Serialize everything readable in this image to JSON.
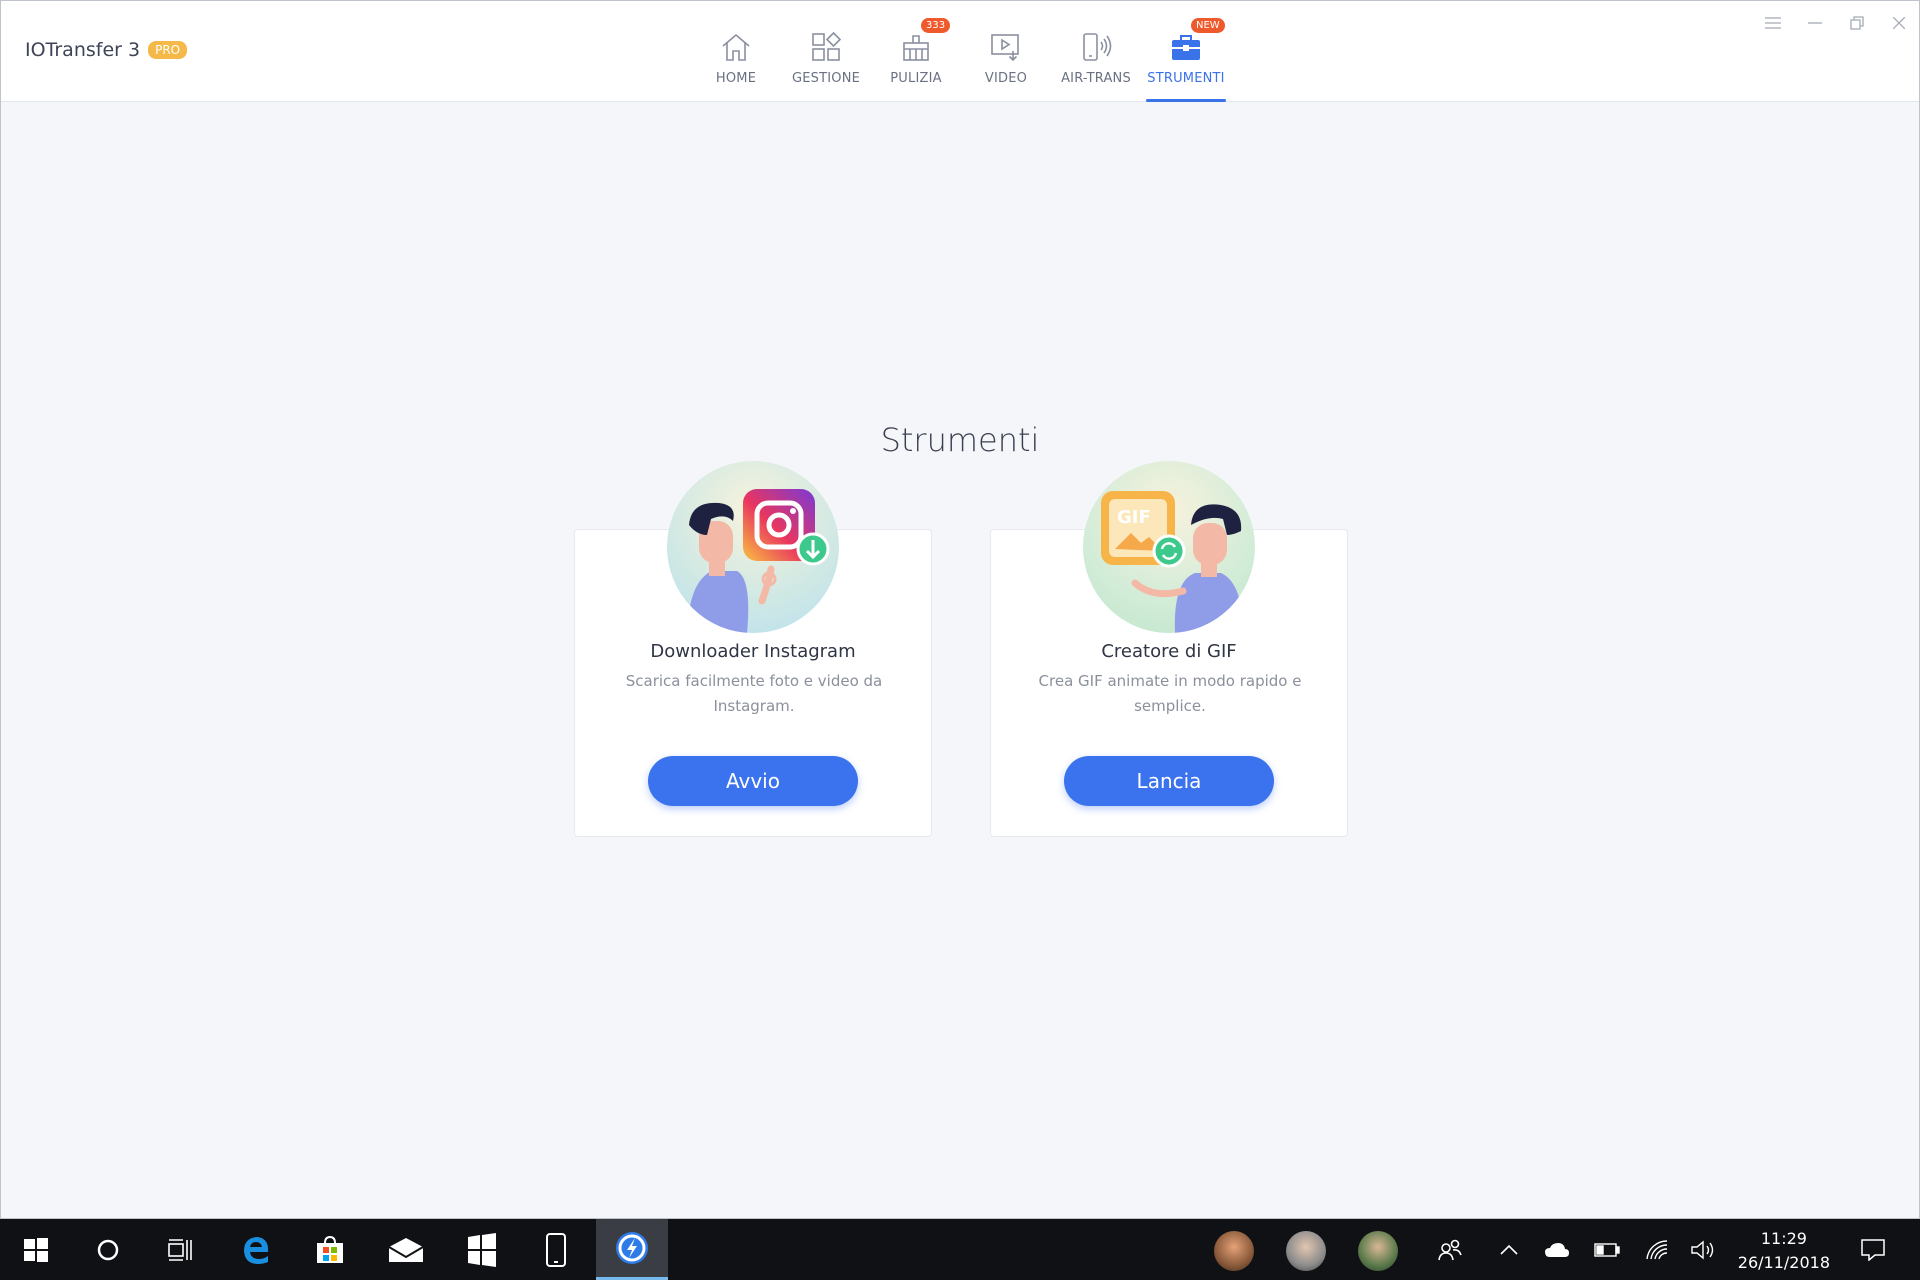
{
  "app": {
    "name": "IOTransfer 3",
    "badge": "PRO"
  },
  "nav": [
    {
      "label": "HOME",
      "icon": "home-icon"
    },
    {
      "label": "GESTIONE",
      "icon": "grid-manage-icon"
    },
    {
      "label": "PULIZIA",
      "icon": "broom-clean-icon",
      "badge": "333"
    },
    {
      "label": "VIDEO",
      "icon": "video-download-icon"
    },
    {
      "label": "AIR-TRANS",
      "icon": "phone-wireless-icon"
    },
    {
      "label": "STRUMENTI",
      "icon": "toolbox-icon",
      "badge": "NEW",
      "active": true
    }
  ],
  "window_controls": [
    "menu-icon",
    "minimize-icon",
    "restore-icon",
    "close-icon"
  ],
  "main": {
    "title": "Strumenti",
    "cards": [
      {
        "title": "Downloader Instagram",
        "description": "Scarica facilmente foto e video da Instagram.",
        "button": "Avvio",
        "icon": "instagram-download-icon"
      },
      {
        "title": "Creatore di GIF",
        "description": "Crea GIF animate in modo rapido e semplice.",
        "button": "Lancia",
        "icon": "gif-convert-icon",
        "icon_text": "GIF"
      }
    ]
  },
  "taskbar": {
    "time": "11:29",
    "date": "26/11/2018",
    "apps": [
      "windows-start-icon",
      "cortana-icon",
      "task-view-icon",
      "edge-icon",
      "store-icon",
      "mail-icon",
      "windows-app-icon",
      "phone-icon",
      "iotransfer-icon"
    ],
    "tray": [
      "people-icon",
      "chevron-up-icon",
      "onedrive-icon",
      "battery-icon",
      "wifi-icon",
      "volume-icon",
      "notification-icon"
    ]
  },
  "colors": {
    "accent": "#3b72ee",
    "badge": "#ef5a2c",
    "pro": "#f5b94a",
    "background": "#f5f6fa"
  }
}
